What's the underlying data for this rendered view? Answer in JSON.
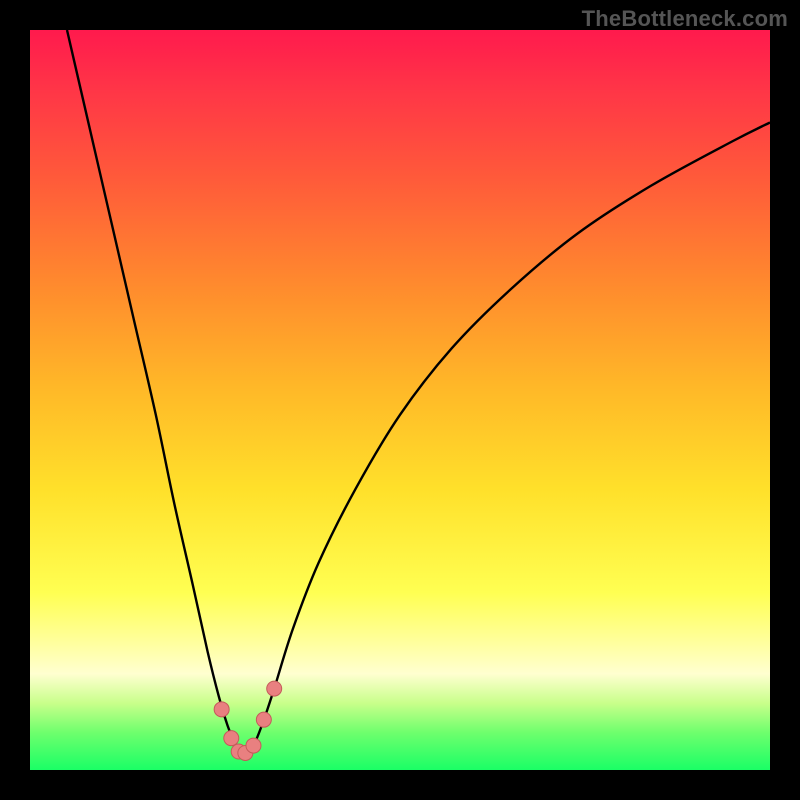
{
  "watermark": "TheBottleneck.com",
  "colors": {
    "background": "#000000",
    "gradient_top": "#ff1a4d",
    "gradient_bottom": "#1aff66",
    "curve": "#000000",
    "marker_fill": "#e98080",
    "marker_stroke": "#c45a5a"
  },
  "chart_data": {
    "type": "line",
    "title": "",
    "xlabel": "",
    "ylabel": "",
    "xlim": [
      0,
      100
    ],
    "ylim": [
      0,
      100
    ],
    "series": [
      {
        "name": "bottleneck-curve",
        "x": [
          5,
          8,
          11,
          14,
          17,
          19.5,
          22,
          24,
          25.5,
          26.7,
          27.7,
          28.5,
          29.3,
          30.3,
          31.5,
          33,
          35.5,
          39,
          44,
          50,
          57,
          65,
          74,
          84,
          95,
          100
        ],
        "values": [
          100,
          87,
          74,
          61,
          48,
          36,
          25,
          16,
          10,
          6,
          3.5,
          2.2,
          2.2,
          3.5,
          6.5,
          11,
          19,
          28,
          38,
          48,
          57,
          65,
          72.5,
          79,
          85,
          87.5
        ]
      }
    ],
    "markers": {
      "name": "highlight-points",
      "x": [
        25.9,
        27.2,
        28.2,
        29.1,
        30.2,
        31.6,
        33.0
      ],
      "values": [
        8.2,
        4.3,
        2.5,
        2.3,
        3.3,
        6.8,
        11.0
      ]
    }
  }
}
